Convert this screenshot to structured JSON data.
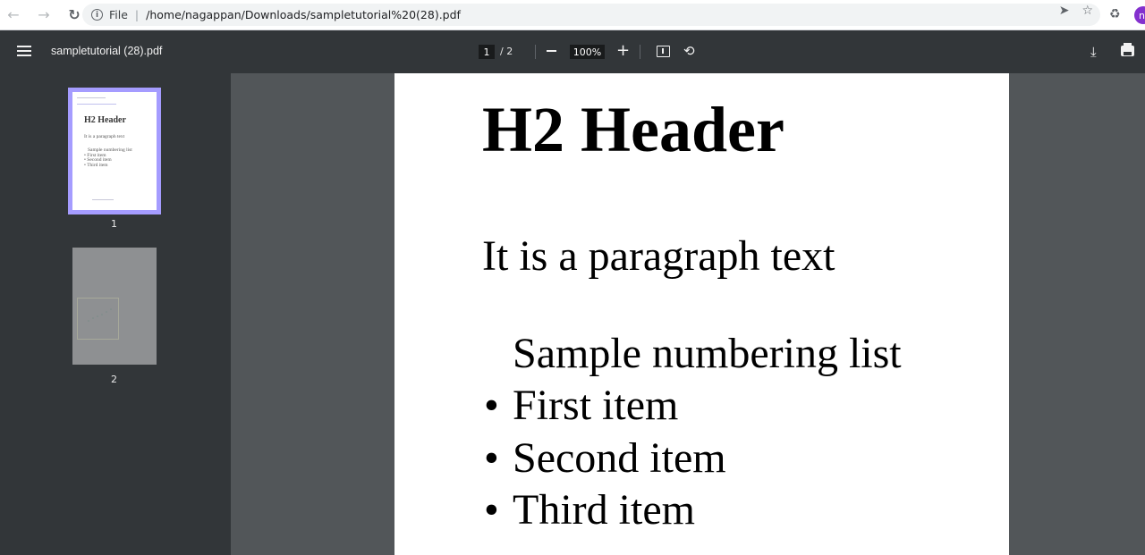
{
  "browser": {
    "scheme": "File",
    "url": "/home/nagappan/Downloads/sampletutorial%20(28).pdf",
    "avatar_initial": "n"
  },
  "toolbar": {
    "title": "sampletutorial (28).pdf",
    "current_page": "1",
    "page_total": "/ 2",
    "zoom": "100%"
  },
  "sidebar": {
    "thumbnails": [
      {
        "label": "1",
        "selected": true,
        "mini_header": "H2 Header",
        "mini_para": "It is a paragraph text",
        "mini_list_head": "Sample numbering list",
        "mini_items": [
          "• First item",
          "• Second item",
          "• Third item"
        ]
      },
      {
        "label": "2",
        "selected": false
      }
    ]
  },
  "page": {
    "heading": "H2 Header",
    "paragraph": "It is a paragraph text",
    "list_heading": "Sample numbering list",
    "items": [
      "First item",
      "Second item",
      "Third item"
    ]
  },
  "icons": {
    "back": "arrow-left-icon",
    "forward": "arrow-right-icon",
    "reload": "reload-icon",
    "info": "info-icon",
    "send": "send-icon",
    "star": "star-icon",
    "extensions": "puzzle-icon",
    "menu": "hamburger-icon",
    "zoom_out": "minus-icon",
    "zoom_in": "plus-icon",
    "fit": "fit-page-icon",
    "rotate": "rotate-icon",
    "download": "download-icon",
    "print": "print-icon"
  },
  "colors": {
    "toolbar_bg": "#323639",
    "viewer_bg": "#525659",
    "thumb_selected": "#a59cff",
    "avatar": "#8430ce"
  }
}
